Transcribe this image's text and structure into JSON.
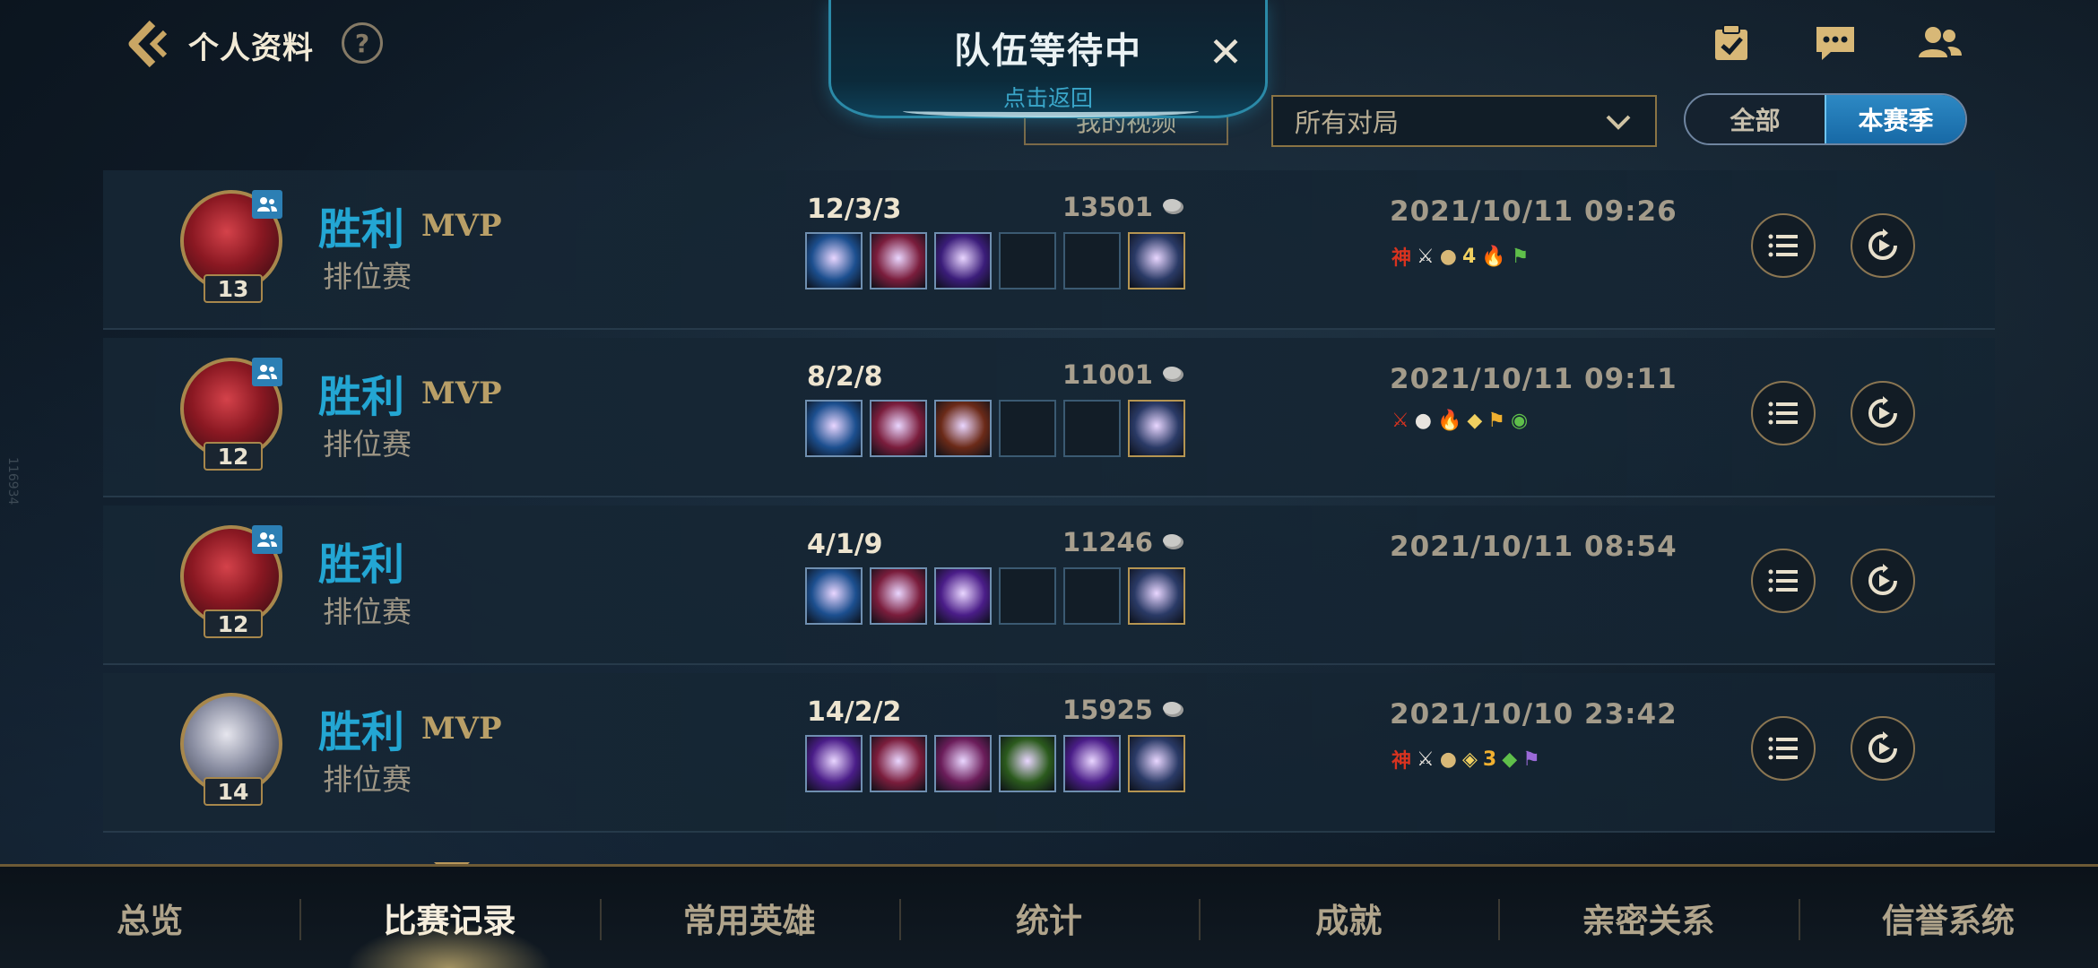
{
  "header": {
    "title": "个人资料",
    "help": "?"
  },
  "queue": {
    "title": "队伍等待中",
    "subtitle": "点击返回",
    "close": "✕"
  },
  "filters": {
    "video_label": "我的视频",
    "dropdown_value": "所有对局",
    "toggle_all": "全部",
    "toggle_season": "本赛季"
  },
  "matches": [
    {
      "level": "13",
      "result": "胜利",
      "mvp": "MVP",
      "mode": "排位赛",
      "kda": "12/3/3",
      "gold": "13501",
      "date": "2021/10/11 09:26",
      "champion_color": "#8a1822",
      "items": [
        "filled",
        "filled",
        "filled",
        "empty",
        "empty",
        "trinket"
      ],
      "badges": [
        "神",
        "⚔",
        "●",
        "4",
        "🔥",
        "⚑"
      ]
    },
    {
      "level": "12",
      "result": "胜利",
      "mvp": "MVP",
      "mode": "排位赛",
      "kda": "8/2/8",
      "gold": "11001",
      "date": "2021/10/11 09:11",
      "champion_color": "#8a1822",
      "items": [
        "filled",
        "filled",
        "filled",
        "empty",
        "empty",
        "trinket"
      ],
      "badges": [
        "⚔",
        "●",
        "🔥",
        "◆",
        "⚑",
        "◉"
      ]
    },
    {
      "level": "12",
      "result": "胜利",
      "mvp": "",
      "mode": "排位赛",
      "kda": "4/1/9",
      "gold": "11246",
      "date": "2021/10/11 08:54",
      "champion_color": "#8a1822",
      "items": [
        "filled",
        "filled",
        "filled",
        "empty",
        "empty",
        "trinket"
      ],
      "badges": []
    },
    {
      "level": "14",
      "result": "胜利",
      "mvp": "MVP",
      "mode": "排位赛",
      "kda": "14/2/2",
      "gold": "15925",
      "date": "2021/10/10 23:42",
      "champion_color": "#c9cad6",
      "items": [
        "filled",
        "filled",
        "filled",
        "filled",
        "filled",
        "trinket"
      ],
      "badges": [
        "神",
        "⚔",
        "●",
        "◈",
        "3",
        "◆",
        "⚑"
      ]
    }
  ],
  "bottom_nav": [
    "总览",
    "比赛记录",
    "常用英雄",
    "统计",
    "成就",
    "亲密关系",
    "信誉系统"
  ],
  "side_label": "116934",
  "colors": {
    "win": "#23a6d3",
    "mvp": "#b99f67",
    "accent_gold": "#a7874c"
  }
}
